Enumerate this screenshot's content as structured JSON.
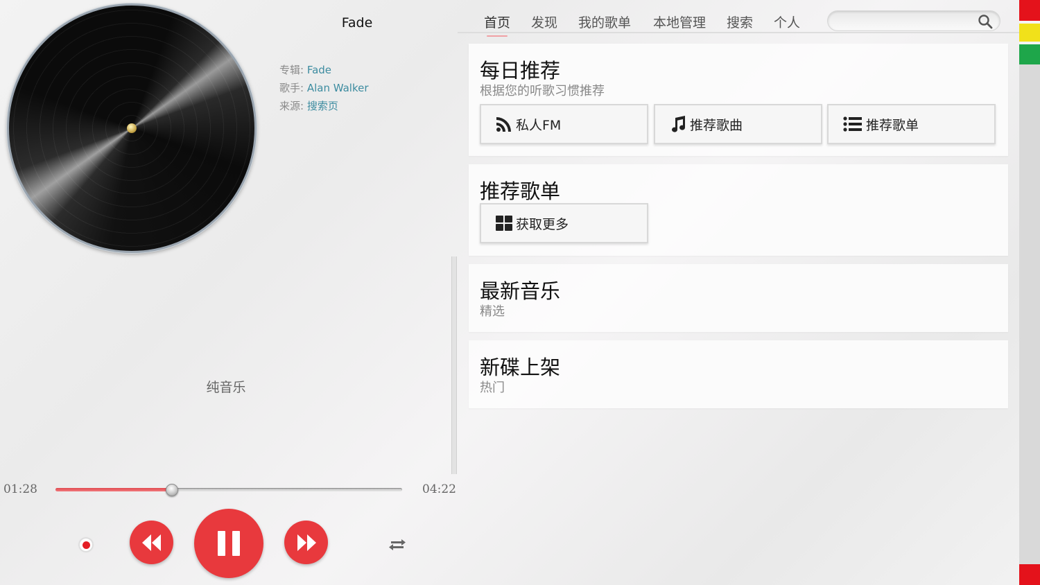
{
  "player": {
    "song_title": "Fade",
    "album_label": "专辑: ",
    "album_value": "Fade",
    "artist_label": "歌手: ",
    "artist_value": "Alan Walker",
    "source_label": "来源: ",
    "source_value": "搜索页",
    "lyric": "纯音乐",
    "time_current": "01:28",
    "time_total": "04:22",
    "progress": 0.336
  },
  "nav": {
    "items": [
      "首页",
      "发现",
      "我的歌单",
      "本地管理",
      "搜索",
      "个人"
    ],
    "active_index": 0,
    "search_placeholder": ""
  },
  "cards": {
    "daily": {
      "title": "每日推荐",
      "subtitle": "根据您的听歌习惯推荐",
      "tiles": [
        {
          "label": "私人FM",
          "icon": "rss-icon"
        },
        {
          "label": "推荐歌曲",
          "icon": "music-note-icon"
        },
        {
          "label": "推荐歌单",
          "icon": "list-icon"
        }
      ]
    },
    "playlists": {
      "title": "推荐歌单",
      "tiles": [
        {
          "label": "获取更多",
          "icon": "grid-icon"
        }
      ]
    },
    "new_music": {
      "title": "最新音乐",
      "subtitle": "精选"
    },
    "new_albums": {
      "title": "新碟上架",
      "subtitle": "热门"
    }
  },
  "colors": {
    "accent_red": "#e8393d",
    "link_teal": "#3d8ca0",
    "strip_red": "#e4121b",
    "strip_yellow": "#f1e11a",
    "strip_green": "#1ea64a"
  }
}
